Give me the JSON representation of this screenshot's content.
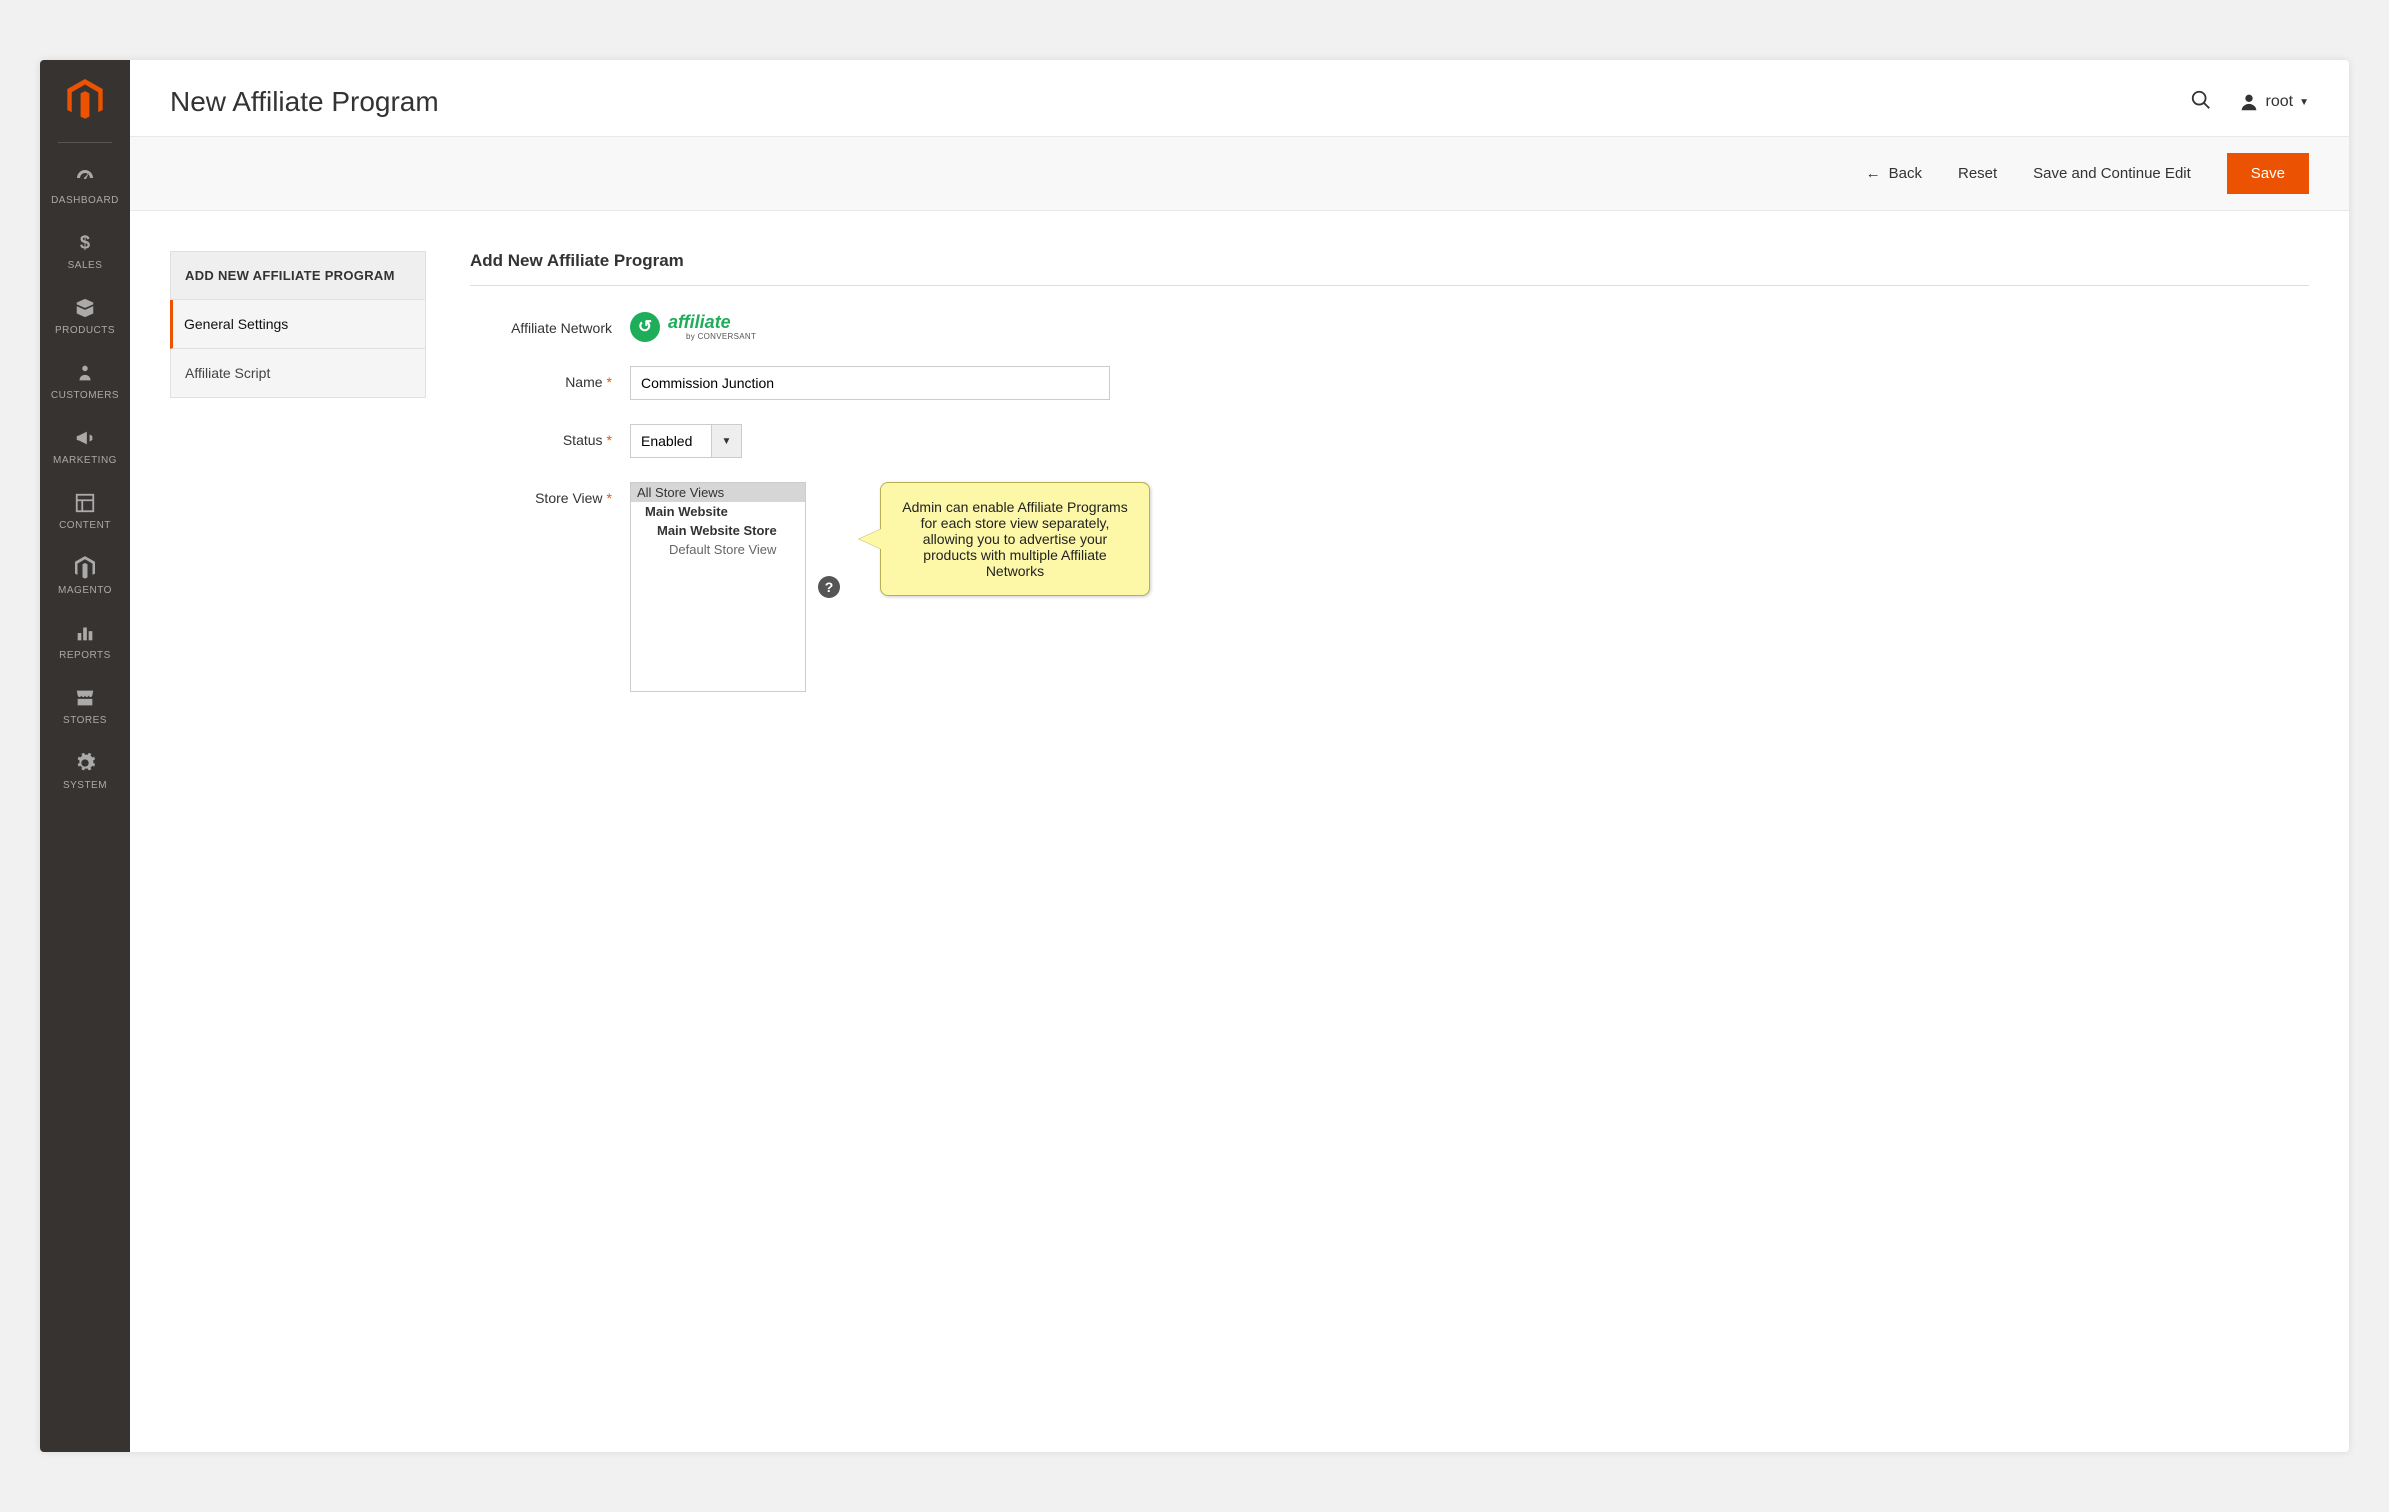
{
  "header": {
    "title": "New Affiliate Program",
    "user": "root"
  },
  "actions": {
    "back": "Back",
    "reset": "Reset",
    "save_continue": "Save and Continue Edit",
    "save": "Save"
  },
  "sidebar": {
    "items": [
      {
        "label": "DASHBOARD"
      },
      {
        "label": "SALES"
      },
      {
        "label": "PRODUCTS"
      },
      {
        "label": "CUSTOMERS"
      },
      {
        "label": "MARKETING"
      },
      {
        "label": "CONTENT"
      },
      {
        "label": "MAGENTO"
      },
      {
        "label": "REPORTS"
      },
      {
        "label": "STORES"
      },
      {
        "label": "SYSTEM"
      }
    ]
  },
  "tabs": {
    "header": "ADD NEW AFFILIATE PROGRAM",
    "items": [
      {
        "label": "General Settings",
        "active": true
      },
      {
        "label": "Affiliate Script",
        "active": false
      }
    ]
  },
  "form": {
    "section_title": "Add New Affiliate Program",
    "labels": {
      "network": "Affiliate Network",
      "name": "Name",
      "status": "Status",
      "store_view": "Store View"
    },
    "network_brand": "affiliate",
    "network_sub": "by CONVERSANT",
    "name_value": "Commission Junction",
    "status_value": "Enabled",
    "store_options": [
      {
        "label": "All Store Views",
        "indent": 0,
        "selected": true
      },
      {
        "label": "Main Website",
        "indent": 1,
        "selected": false
      },
      {
        "label": "Main Website Store",
        "indent": 2,
        "selected": false
      },
      {
        "label": "Default Store View",
        "indent": 3,
        "selected": false
      }
    ]
  },
  "callout": {
    "text": "Admin can enable Affiliate Programs for each store view separately, allowing you to advertise your products with multiple Affiliate Networks"
  }
}
